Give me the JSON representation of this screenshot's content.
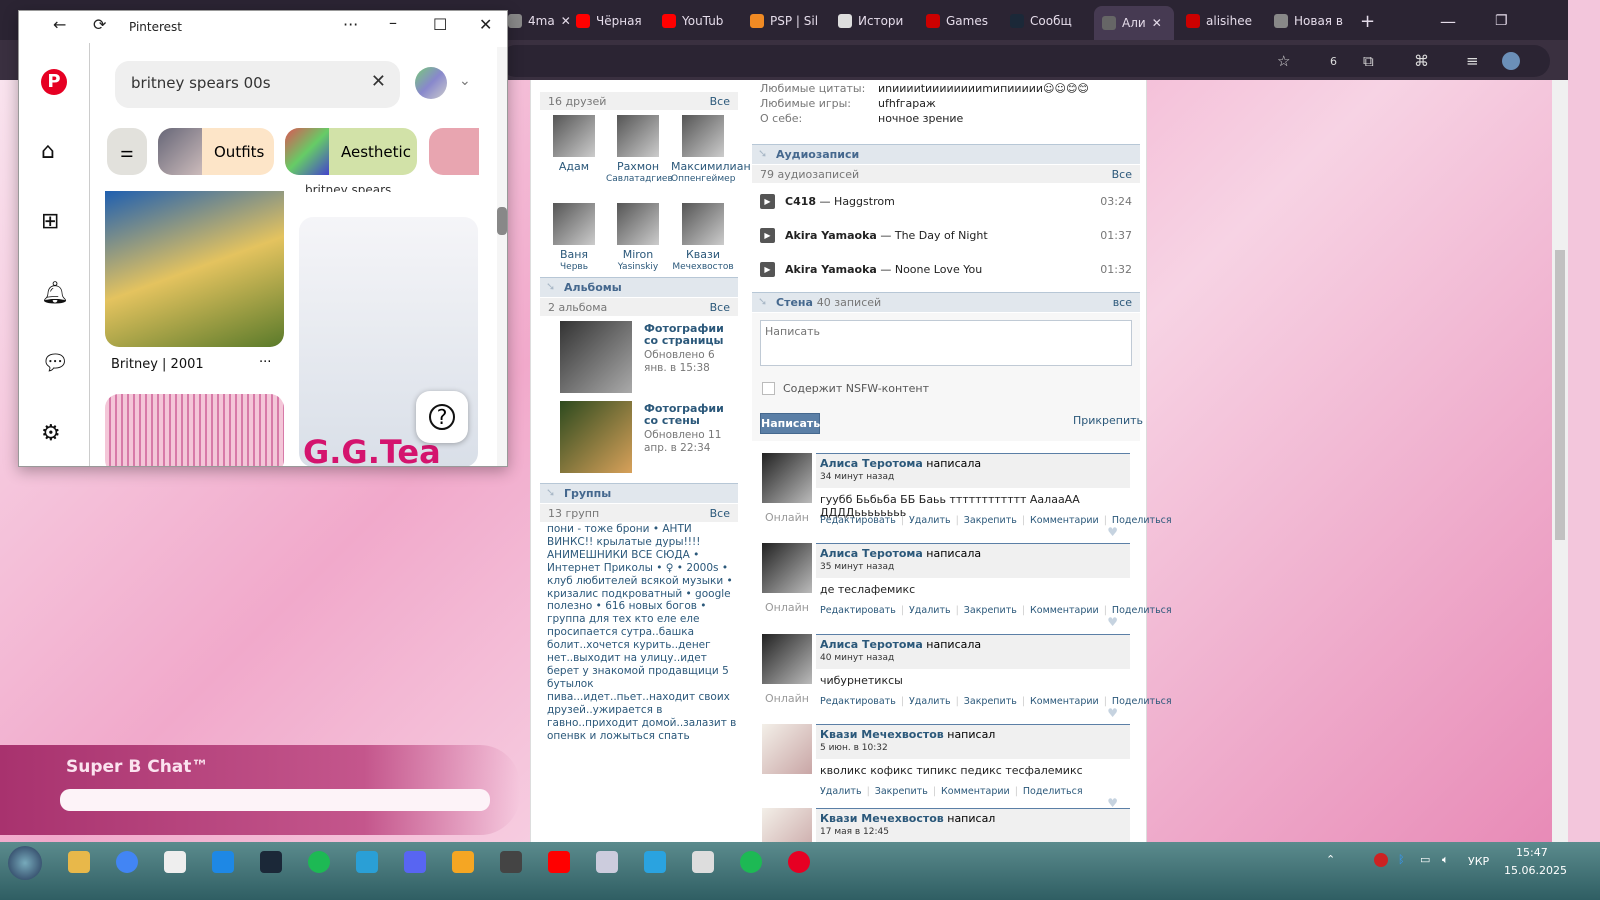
{
  "browser": {
    "tabs": [
      {
        "label": "4ma",
        "color": "#888"
      },
      {
        "label": "Чёрная",
        "color": "#ff0000"
      },
      {
        "label": "YouTub",
        "color": "#ff0000"
      },
      {
        "label": "PSP | Sil",
        "color": "#f08a24"
      },
      {
        "label": "Истори",
        "color": "#ddd"
      },
      {
        "label": "Games",
        "color": "#c00"
      },
      {
        "label": "Сообщ",
        "color": "#1b2838"
      },
      {
        "label": "Али",
        "color": "#666"
      },
      {
        "label": "alisihee",
        "color": "#c00"
      },
      {
        "label": "Новая в",
        "color": "#888"
      }
    ],
    "new_tab": "+",
    "close": "✕",
    "ext_badge": "6"
  },
  "pinterest": {
    "title": "Pinterest",
    "search_value": "britney spears 00s",
    "chips": [
      "Outfits",
      "Aesthetic"
    ],
    "pins": [
      {
        "caption": "Britney | 2001",
        "more": "···"
      },
      {
        "caption": "britney spears"
      }
    ],
    "overlay_text": "G.G.Tea",
    "help": "?"
  },
  "vk": {
    "friends": {
      "count": "16 друзей",
      "all": "Все",
      "items": [
        {
          "first": "Адам",
          "last": ""
        },
        {
          "first": "Рахмон",
          "last": "Савлатадгиев"
        },
        {
          "first": "Максимилиан",
          "last": "Оппенгеймер"
        },
        {
          "first": "Ваня",
          "last": "Червь"
        },
        {
          "first": "Miron",
          "last": "Yasinskiy"
        },
        {
          "first": "Квази",
          "last": "Мечехвостов"
        }
      ]
    },
    "albums": {
      "title": "Альбомы",
      "count": "2 альбома",
      "all": "Все",
      "items": [
        {
          "name": "Фотографии со страницы",
          "updated": "Обновлено 6 янв. в 15:38"
        },
        {
          "name": "Фотографии со стены",
          "updated": "Обновлено 11 апр. в 22:34"
        }
      ]
    },
    "groups": {
      "title": "Группы",
      "count": "13 групп",
      "all": "Все",
      "text": "пони - тоже брони • АНТИ ВИНКС!! крылатые дуры!!!! АНИМЕШНИКИ ВСЕ СЮДА • Интернет Приколы • ♀ • 2000s • клуб любителей всякой музыки • кризалис подкроватный • google полезно • 616 новых богов • группа для тех кто еле еле просипается сутра..башка болит..хочется курить..денег нет..выходит на улицу..идет берет у знакомой продавщици 5 бутылок пива...идет..пьет..находит своих друзей..ужирается в гавно..приходит домой..залазит в опенвк и ложыться спать"
    },
    "info": [
      {
        "k": "Любимые цитаты:",
        "v": "иnииииtииииииииmипиииии☺☺😊😊"
      },
      {
        "k": "Любимые игры:",
        "v": "ufhfгараж"
      },
      {
        "k": "О себе:",
        "v": "ночное зрение"
      }
    ],
    "audio": {
      "title": "Аудиозаписи",
      "count": "79 аудиозаписей",
      "all": "Все",
      "items": [
        {
          "artist": "C418",
          "title": "Haggstrom",
          "time": "03:24"
        },
        {
          "artist": "Akira Yamaoka",
          "title": "The Day of Night",
          "time": "01:37"
        },
        {
          "artist": "Akira Yamaoka",
          "title": "Noone Love You",
          "time": "01:32"
        }
      ]
    },
    "wall": {
      "title": "Стена",
      "count": "40 записей",
      "all": "все",
      "placeholder": "Написать",
      "nsfw": "Содержит NSFW-контент",
      "submit": "Написать",
      "attach": "Прикрепить",
      "actions": {
        "edit": "Редактировать",
        "delete": "Удалить",
        "pin": "Закрепить",
        "comments": "Комментарии",
        "share": "Поделиться"
      },
      "online": "Онлайн",
      "posts": [
        {
          "author": "Алиса Теротома",
          "verb": "написала",
          "time": "34 минут назад",
          "text": "гуубб Бьбьба ББ Баьь тттттттттттт АалааАА ДДДДьььььььь"
        },
        {
          "author": "Алиса Теротома",
          "verb": "написала",
          "time": "35 минут назад",
          "text": "де теслафемикс"
        },
        {
          "author": "Алиса Теротома",
          "verb": "написала",
          "time": "40 минут назад",
          "text": "чибурнетиксы"
        },
        {
          "author": "Квази Мечехвостов",
          "verb": "написал",
          "time": "5 июн. в 10:32",
          "text": "кволикс кофикс типикс педикс тесфалемикс"
        },
        {
          "author": "Квази Мечехвостов",
          "verb": "написал",
          "time": "17 мая в 12:45",
          "text": ""
        }
      ]
    }
  },
  "background": {
    "chat_title": "Super B Chat™"
  },
  "taskbar": {
    "lang": "УКР",
    "time": "15:47",
    "date": "15.06.2025"
  }
}
